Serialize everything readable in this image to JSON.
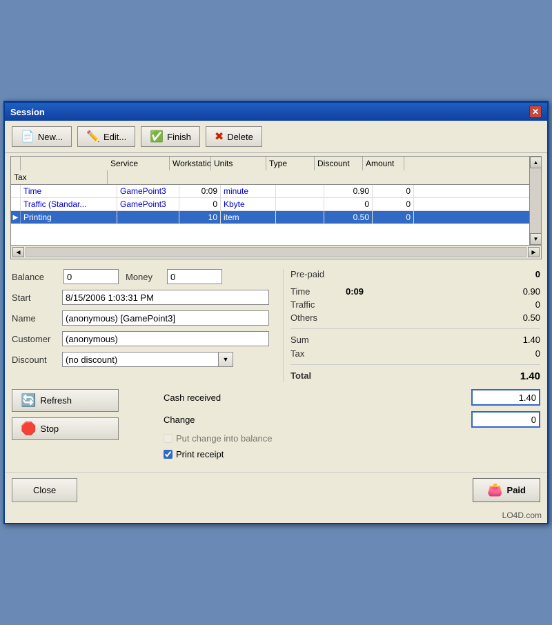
{
  "window": {
    "title": "Session"
  },
  "toolbar": {
    "new_label": "New...",
    "edit_label": "Edit...",
    "finish_label": "Finish",
    "delete_label": "Delete"
  },
  "table": {
    "headers": [
      "Service",
      "Workstation",
      "Units",
      "Type",
      "Discount",
      "Amount",
      "Tax"
    ],
    "rows": [
      {
        "service": "Time",
        "workstation": "GamePoint3",
        "units": "0:09",
        "type": "minute",
        "discount": "",
        "amount": "0.90",
        "tax": "0",
        "selected": false
      },
      {
        "service": "Traffic (Standard)",
        "workstation": "GamePoint3",
        "units": "0",
        "type": "Kbyte",
        "discount": "",
        "amount": "0",
        "tax": "0",
        "selected": false
      },
      {
        "service": "Printing",
        "workstation": "",
        "units": "10",
        "type": "item",
        "discount": "",
        "amount": "0.50",
        "tax": "0",
        "selected": true
      }
    ]
  },
  "form": {
    "balance_label": "Balance",
    "balance_value": "0",
    "money_label": "Money",
    "money_value": "0",
    "start_label": "Start",
    "start_value": "8/15/2006 1:03:31 PM",
    "name_label": "Name",
    "name_value": "(anonymous) [GamePoint3]",
    "customer_label": "Customer",
    "customer_value": "(anonymous)",
    "discount_label": "Discount",
    "discount_value": "(no discount)"
  },
  "info": {
    "prepaid_label": "Pre-paid",
    "prepaid_value": "0",
    "time_label": "Time",
    "time_value": "0:09",
    "time_amount": "0.90",
    "traffic_label": "Traffic",
    "traffic_value": "0",
    "others_label": "Others",
    "others_value": "0.50",
    "sum_label": "Sum",
    "sum_value": "1.40",
    "tax_label": "Tax",
    "tax_value": "0",
    "total_label": "Total",
    "total_value": "1.40"
  },
  "actions": {
    "refresh_label": "Refresh",
    "stop_label": "Stop",
    "close_label": "Close",
    "paid_label": "Paid"
  },
  "payment": {
    "cash_received_label": "Cash received",
    "cash_received_value": "1.40",
    "change_label": "Change",
    "change_value": "0",
    "put_change_label": "Put change into balance",
    "print_receipt_label": "Print receipt",
    "print_receipt_checked": true
  },
  "watermark": "LO4D.com"
}
